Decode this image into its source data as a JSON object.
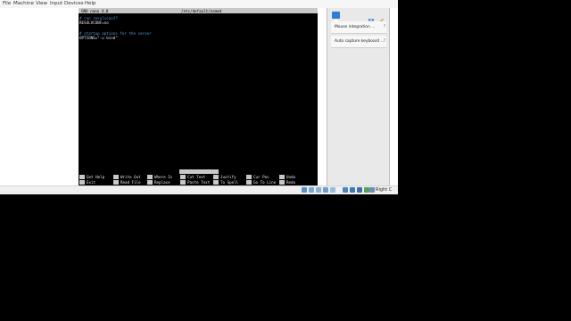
{
  "menubar": {
    "items": [
      "File",
      "Machine",
      "View",
      "Input",
      "Devices",
      "Help"
    ]
  },
  "terminal": {
    "title_left": "GNU nano 4.8",
    "title_center": "/etc/default/named",
    "lines": [
      {
        "text": "# run resolvconf?",
        "kind": "comment"
      },
      {
        "text": "RESOLVCONF=no",
        "kind": "text"
      },
      {
        "text": "",
        "kind": "text"
      },
      {
        "text": "# startup options for the server",
        "kind": "comment"
      },
      {
        "text": "OPTIONS=\"-u bind\"",
        "kind": "text"
      }
    ],
    "status_message": "[ Read 5 lines ]",
    "shortcuts": [
      {
        "key": "^G",
        "label": "Get Help"
      },
      {
        "key": "^O",
        "label": "Write Out"
      },
      {
        "key": "^W",
        "label": "Where Is"
      },
      {
        "key": "^K",
        "label": "Cut Text"
      },
      {
        "key": "^J",
        "label": "Justify"
      },
      {
        "key": "^C",
        "label": "Cur Pos"
      },
      {
        "key": "M-U",
        "label": "Undo"
      },
      {
        "key": "^X",
        "label": "Exit"
      },
      {
        "key": "^R",
        "label": "Read File"
      },
      {
        "key": "^\\",
        "label": "Replace"
      },
      {
        "key": "^U",
        "label": "Paste Text"
      },
      {
        "key": "^T",
        "label": "To Spell"
      },
      {
        "key": "^_",
        "label": "Go To Line"
      },
      {
        "key": "M-E",
        "label": "Redo"
      }
    ]
  },
  "sidebar": {
    "messages": [
      {
        "text": "Mouse integration ..."
      },
      {
        "text": "Auto capture keyboard ..."
      }
    ]
  },
  "statusbar": {
    "host_key": "Right C"
  },
  "colors": {
    "accent": "#2f7dd1",
    "comment": "#5a9bd8"
  }
}
